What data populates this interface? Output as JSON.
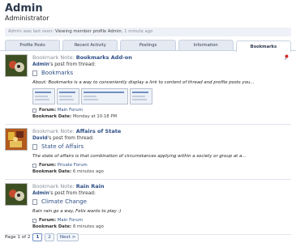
{
  "profile": {
    "name": "Admin",
    "role": "Administrator",
    "last_seen_label": "Admin was last seen:",
    "last_seen_activity": "Viewing member profile Admin",
    "last_seen_time": ", 1 minute ago"
  },
  "tabs": [
    {
      "label": "Profile Posts",
      "active": false
    },
    {
      "label": "Recent Activity",
      "active": false
    },
    {
      "label": "Postings",
      "active": false
    },
    {
      "label": "Information",
      "active": false
    },
    {
      "label": "Bookmarks",
      "active": true
    }
  ],
  "bookmarks": [
    {
      "note_label": "Bookmark Note:",
      "note_title": "Bookmarks Add-on",
      "author": "Admin",
      "posted_text": "'s post from thread:",
      "thread": "Bookmarks",
      "excerpt": "About: Bookmarks is a way to conveniently display a link to content of thread and profile posts you...",
      "forum_label": "Forum:",
      "forum": "Main Forum",
      "date_label": "Bookmark Date:",
      "date": "Monday at 10:18 PM"
    },
    {
      "note_label": "Bookmark Note:",
      "note_title": "Affairs of State",
      "author": "David",
      "posted_text": "'s post from thread:",
      "thread": "State of Affairs",
      "excerpt": "The state of affairs is that combination of circumstances applying within a society or group at a...",
      "forum_label": "Forum:",
      "forum": "Private Forum",
      "date_label": "Bookmark Date:",
      "date": "6 minutes ago"
    },
    {
      "note_label": "Bookmark Note:",
      "note_title": "Rain Rain",
      "author": "Admin",
      "posted_text": "'s post from thread:",
      "thread": "Climate Change",
      "excerpt": "Rain rain go a way, Felix wants to play :)",
      "forum_label": "Forum:",
      "forum": "Main Forum",
      "date_label": "Bookmark Date:",
      "date": "8 minutes ago"
    }
  ],
  "pagination": {
    "label": "Page 1 of 2",
    "pages": [
      "1",
      "2"
    ],
    "current": "1",
    "next": "Next >"
  },
  "colors": {
    "link": "#2e4f86",
    "muted": "#8a8f99",
    "tab_bg": "#e4e9f2"
  }
}
